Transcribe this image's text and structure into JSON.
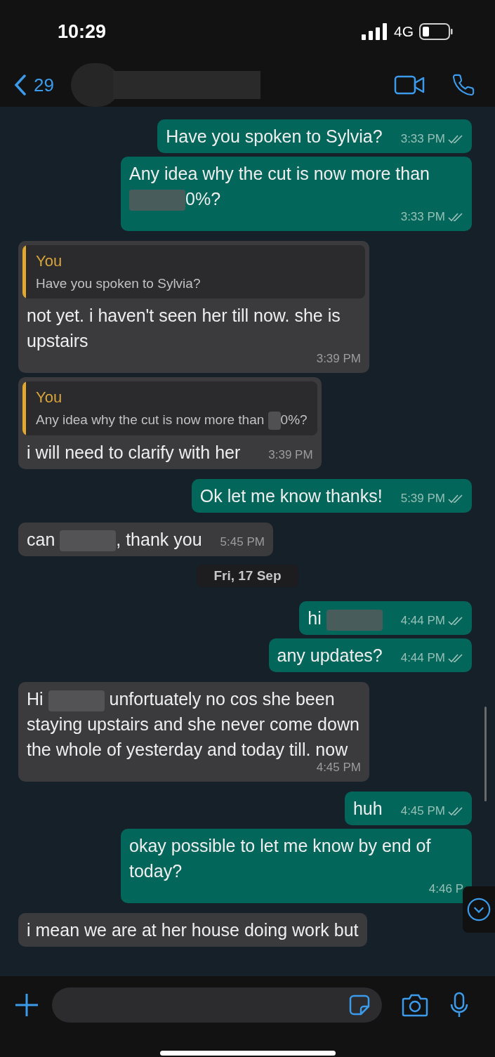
{
  "status_bar": {
    "time": "10:29",
    "network": "4G"
  },
  "header": {
    "back_count": "29"
  },
  "messages": [
    {
      "kind": "sent",
      "parts": [
        {
          "kind": "text",
          "text": "Have you spoken to Sylvia?"
        }
      ],
      "time": "3:33 PM"
    },
    {
      "kind": "sent",
      "parts": [
        {
          "kind": "text",
          "text": "Any idea why the cut is now more than "
        },
        {
          "kind": "redacted"
        },
        {
          "kind": "text",
          "text": "0%?"
        }
      ],
      "time": "3:33 PM"
    },
    {
      "kind": "received",
      "quote": {
        "author": "You",
        "parts": [
          {
            "kind": "text",
            "text": "Have you spoken to Sylvia?"
          }
        ]
      },
      "parts": [
        {
          "kind": "text",
          "text": "not yet. i haven't seen her till now. she is upstairs"
        }
      ],
      "time": "3:39 PM"
    },
    {
      "kind": "received",
      "quote": {
        "author": "You",
        "parts": [
          {
            "kind": "text",
            "text": "Any idea why the cut is now more than "
          },
          {
            "kind": "redacted"
          },
          {
            "kind": "text",
            "text": "0%?"
          }
        ]
      },
      "parts": [
        {
          "kind": "text",
          "text": "i will need to clarify with her"
        }
      ],
      "time": "3:39 PM"
    },
    {
      "kind": "sent",
      "parts": [
        {
          "kind": "text",
          "text": "Ok let me know thanks!"
        }
      ],
      "time": "5:39 PM"
    },
    {
      "kind": "received",
      "parts": [
        {
          "kind": "text",
          "text": "can "
        },
        {
          "kind": "redacted"
        },
        {
          "kind": "text",
          "text": ", thank you"
        }
      ],
      "time": "5:45 PM"
    },
    {
      "kind": "date",
      "text": "Fri, 17 Sep"
    },
    {
      "kind": "sent",
      "parts": [
        {
          "kind": "text",
          "text": "hi "
        },
        {
          "kind": "redacted"
        }
      ],
      "time": "4:44 PM"
    },
    {
      "kind": "sent",
      "parts": [
        {
          "kind": "text",
          "text": "any updates?"
        }
      ],
      "time": "4:44 PM"
    },
    {
      "kind": "received",
      "parts": [
        {
          "kind": "text",
          "text": "Hi "
        },
        {
          "kind": "redacted"
        },
        {
          "kind": "text",
          "text": " unfortuately no cos she been staying upstairs and she never come down the whole of yesterday and today till. now"
        }
      ],
      "time": "4:45 PM"
    },
    {
      "kind": "sent",
      "parts": [
        {
          "kind": "text",
          "text": "huh"
        }
      ],
      "time": "4:45 PM"
    },
    {
      "kind": "sent",
      "parts": [
        {
          "kind": "text",
          "text": "okay possible to let me know by end of today?"
        }
      ],
      "time": "4:46 P",
      "read_ticks": false
    },
    {
      "kind": "received",
      "parts": [
        {
          "kind": "text",
          "text": "i mean we are at her house doing work but"
        }
      ]
    }
  ]
}
